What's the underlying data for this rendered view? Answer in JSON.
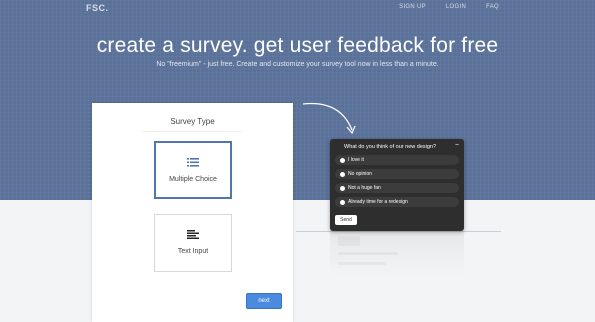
{
  "brand": {
    "logo": "FSC."
  },
  "nav": {
    "signup": "SIGN UP",
    "login": "LOGIN",
    "faq": "FAQ"
  },
  "hero": {
    "headline": "create a survey. get user feedback for free",
    "subline": "No \"freemium\" - just free. Create and customize your survey tool now in less than a minute."
  },
  "survey_type": {
    "title": "Survey Type",
    "options": [
      {
        "label": "Multiple Choice",
        "icon": "list-icon",
        "selected": true
      },
      {
        "label": "Text Input",
        "icon": "text-align-icon",
        "selected": false
      }
    ],
    "next_label": "next"
  },
  "preview": {
    "question": "What do you think of our new design?",
    "close_symbol": "−",
    "options": [
      "I love it",
      "No opinion",
      "Not a huge fan",
      "Already time for a redesign"
    ],
    "send_label": "Send"
  },
  "colors": {
    "hero_bg": "#5a7199",
    "selected_border": "#4f78a8",
    "next_button": "#4a8be0",
    "widget_bg": "#2e2e2e"
  }
}
